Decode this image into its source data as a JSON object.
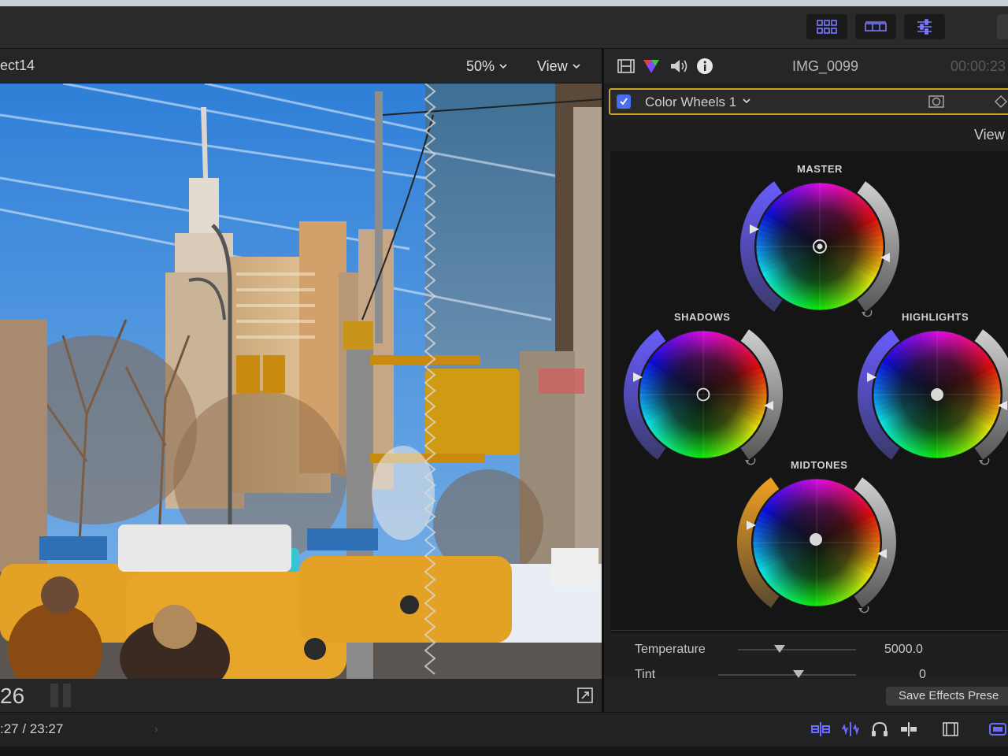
{
  "toolbar": {
    "buttons": [
      {
        "name": "browser-toggle",
        "icon": "grid-icon"
      },
      {
        "name": "timeline-toggle",
        "icon": "filmstrip-icon"
      },
      {
        "name": "inspector-toggle",
        "icon": "sliders-icon"
      }
    ],
    "accent": "#7a7aff"
  },
  "viewer": {
    "project_name": "ect14",
    "zoom": "50%",
    "view_label": "View",
    "timecode": "26",
    "image_desc_icon": "photo"
  },
  "inspector": {
    "clip_name": "IMG_0099",
    "duration": "00:00:23",
    "effect_name": "Color Wheels 1",
    "effect_enabled": true,
    "view_label": "View",
    "wheels": {
      "master": "MASTER",
      "shadows": "SHADOWS",
      "highlights": "HIGHLIGHTS",
      "midtones": "MIDTONES"
    },
    "params": [
      {
        "label": "Temperature",
        "value": "5000.0",
        "level": 0.35
      },
      {
        "label": "Tint",
        "value": "0",
        "level": 0.5
      }
    ],
    "save_button": "Save Effects Prese"
  },
  "status": {
    "timecode": ":27 / 23:27"
  },
  "colors": {
    "border_highlight": "#c9a227",
    "checkbox": "#4a6cf0",
    "midtones_accent": "#f0a020",
    "wheel_accent": "#6a5cff"
  }
}
